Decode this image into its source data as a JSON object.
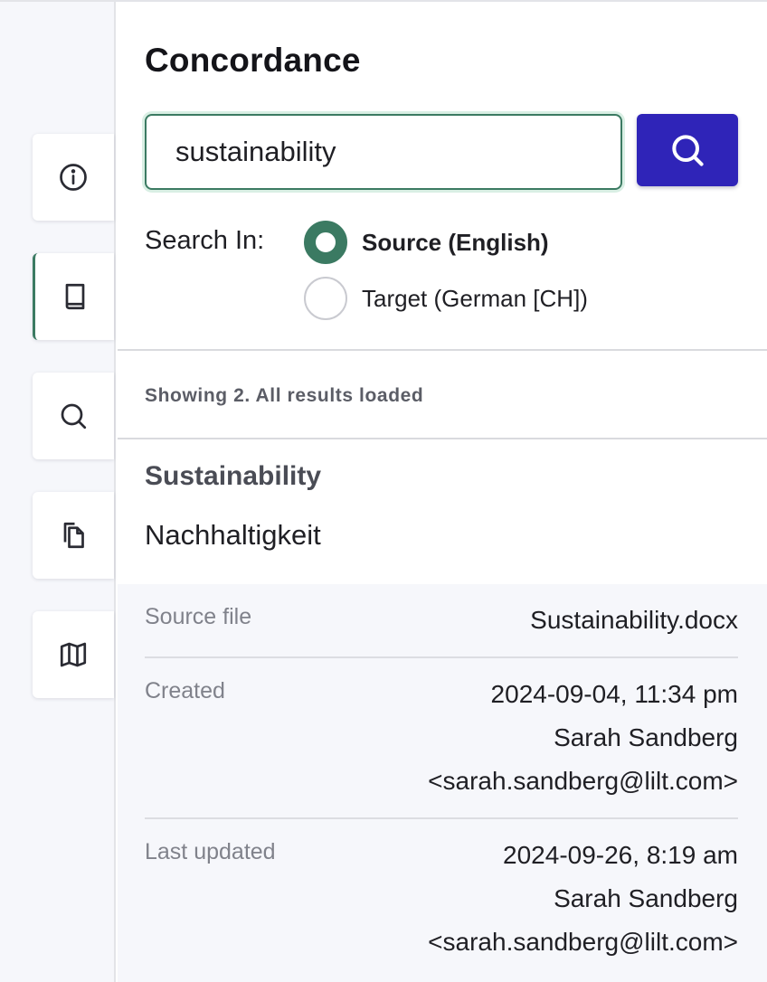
{
  "panel": {
    "title": "Concordance",
    "search": {
      "value": "sustainability",
      "button_icon": "search-icon"
    },
    "search_in": {
      "label": "Search In:",
      "options": [
        {
          "label": "Source (English)",
          "checked": true
        },
        {
          "label": "Target (German [CH])",
          "checked": false
        }
      ]
    },
    "status": "Showing 2. All results loaded",
    "result": {
      "source_text": "Sustainability",
      "target_text": "Nachhaltigkeit",
      "meta": {
        "source_file": {
          "label": "Source file",
          "value": "Sustainability.docx"
        },
        "created": {
          "label": "Created",
          "date": "2024-09-04, 11:34 pm",
          "user": "Sarah Sandberg",
          "email": "<sarah.sandberg@lilt.com>"
        },
        "last_updated": {
          "label": "Last updated",
          "date": "2024-09-26, 8:19 am",
          "user": "Sarah Sandberg",
          "email": "<sarah.sandberg@lilt.com>"
        }
      }
    }
  },
  "rail": {
    "items": [
      "info-icon",
      "book-icon",
      "search-icon",
      "files-icon",
      "map-icon"
    ],
    "active": "book-icon"
  },
  "colors": {
    "accent_green": "#3b7a62",
    "primary_button": "#2f24b8",
    "rail_background": "#f6f7fb"
  }
}
